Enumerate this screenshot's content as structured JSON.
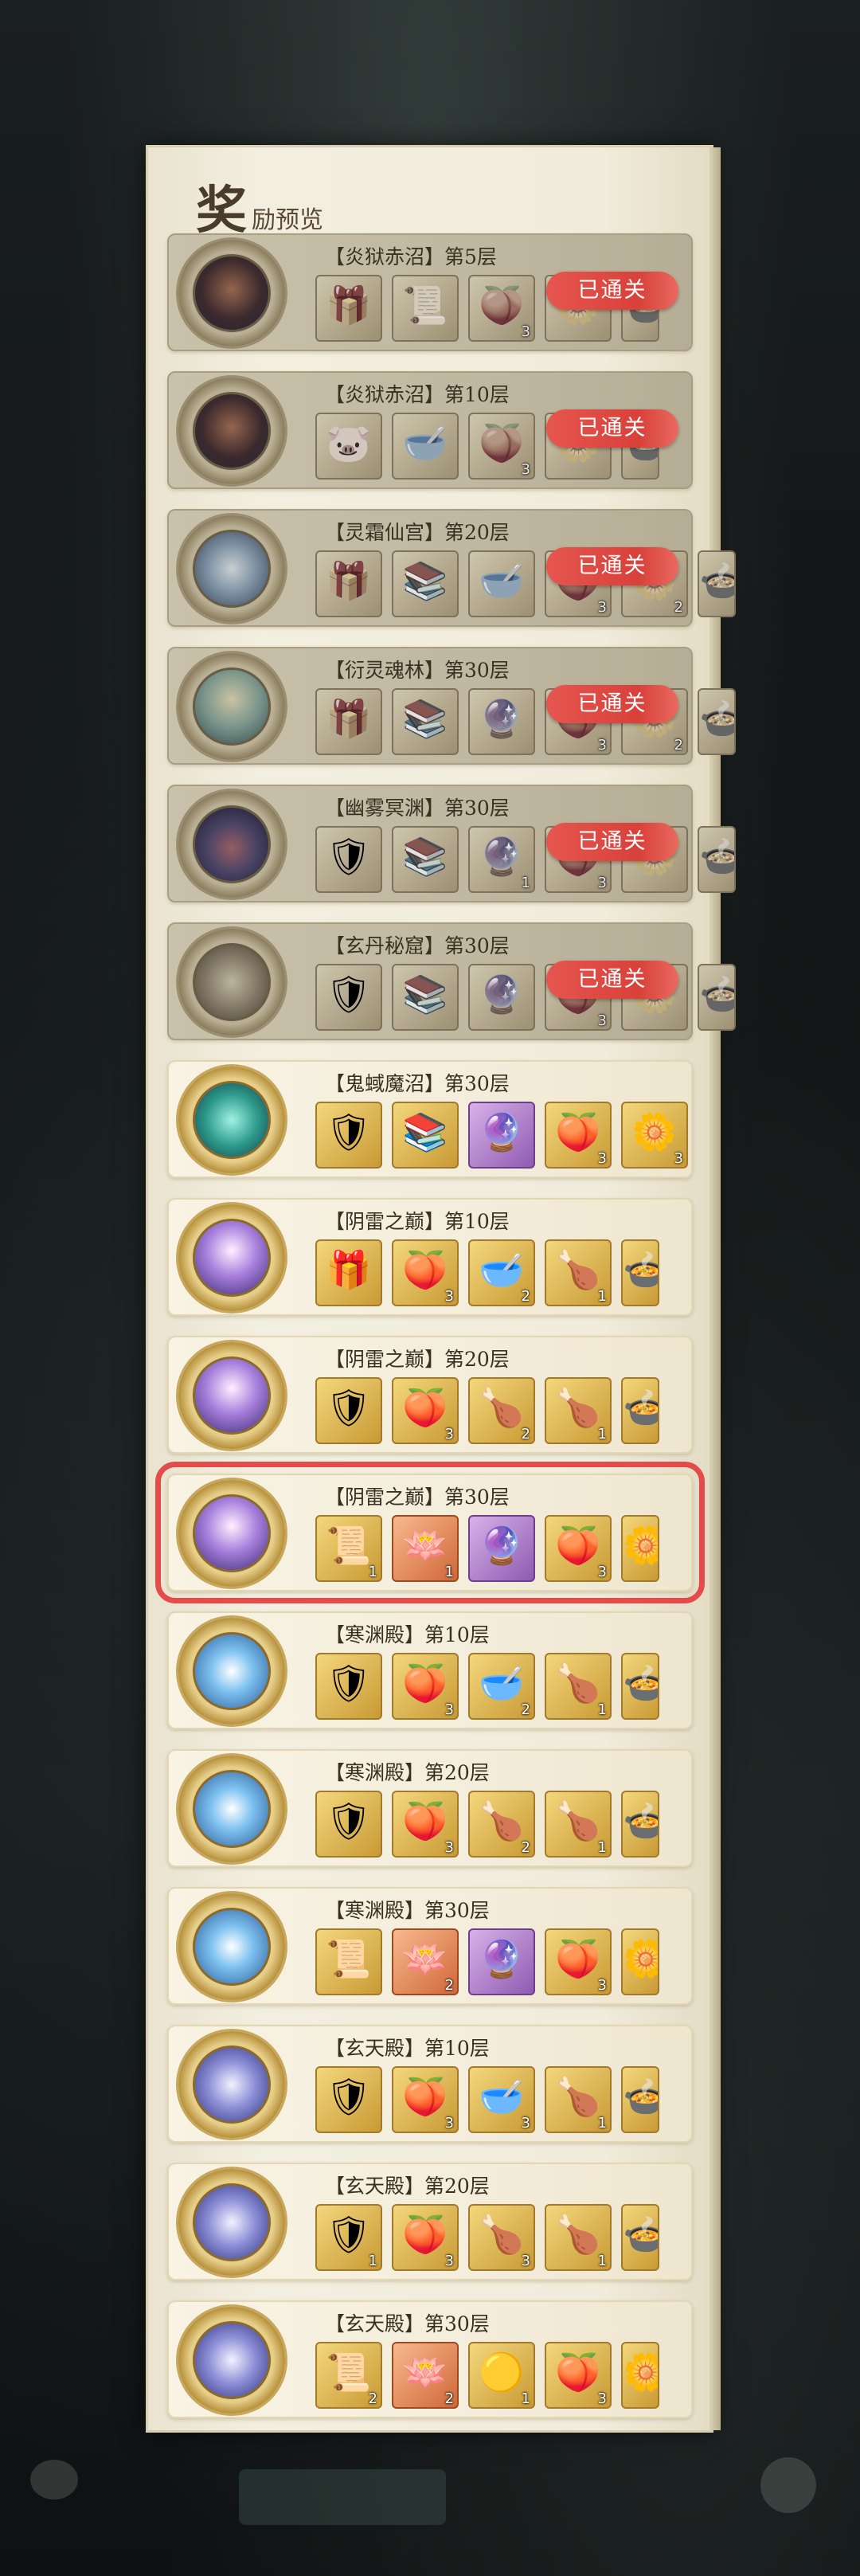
{
  "panel": {
    "title_big": "奖",
    "title_small": "励预览"
  },
  "passed_label": "已通关",
  "stages": [
    {
      "name": "【炎狱赤沼】第5层",
      "theme": "fire",
      "passed": true,
      "selected": false,
      "items": [
        {
          "icon": "chest-icon",
          "glyph": "🎁",
          "quality": "gold",
          "qty": ""
        },
        {
          "icon": "scroll-icon",
          "glyph": "📜",
          "quality": "gold",
          "qty": ""
        },
        {
          "icon": "peach-icon",
          "glyph": "🍑",
          "quality": "gold",
          "qty": "3"
        },
        {
          "icon": "lotus-icon",
          "glyph": "🌼",
          "quality": "gold",
          "qty": ""
        },
        {
          "icon": "dish-icon",
          "glyph": "🍲",
          "quality": "gold",
          "qty": "",
          "cut": true
        }
      ]
    },
    {
      "name": "【炎狱赤沼】第10层",
      "theme": "fire",
      "passed": true,
      "selected": false,
      "items": [
        {
          "icon": "spirit-beast-icon",
          "glyph": "🐷",
          "quality": "gold",
          "qty": ""
        },
        {
          "icon": "green-bowl-icon",
          "glyph": "🥣",
          "quality": "gold",
          "qty": ""
        },
        {
          "icon": "peach-icon",
          "glyph": "🍑",
          "quality": "gold",
          "qty": "3"
        },
        {
          "icon": "lotus-icon",
          "glyph": "🌼",
          "quality": "gold",
          "qty": ""
        },
        {
          "icon": "dish-icon",
          "glyph": "🍲",
          "quality": "gold",
          "qty": "",
          "cut": true
        }
      ]
    },
    {
      "name": "【灵霜仙宫】第20层",
      "theme": "frost",
      "passed": true,
      "selected": false,
      "items": [
        {
          "icon": "chest-icon",
          "glyph": "🎁",
          "quality": "gold",
          "qty": ""
        },
        {
          "icon": "book-icon",
          "glyph": "📚",
          "quality": "gold",
          "qty": ""
        },
        {
          "icon": "jade-bowl-icon",
          "glyph": "🥣",
          "quality": "gold",
          "qty": ""
        },
        {
          "icon": "peach-icon",
          "glyph": "🍑",
          "quality": "gold",
          "qty": "3"
        },
        {
          "icon": "lotus-icon",
          "glyph": "🌼",
          "quality": "gold",
          "qty": "2"
        },
        {
          "icon": "dish-icon",
          "glyph": "🍲",
          "quality": "gold",
          "qty": "",
          "cut": true
        }
      ]
    },
    {
      "name": "【衍灵魂林】第30层",
      "theme": "wood",
      "passed": true,
      "selected": false,
      "items": [
        {
          "icon": "chest-icon",
          "glyph": "🎁",
          "quality": "gold",
          "qty": ""
        },
        {
          "icon": "book-icon",
          "glyph": "📚",
          "quality": "gold",
          "qty": ""
        },
        {
          "icon": "orb-icon",
          "glyph": "🔮",
          "quality": "gold",
          "qty": ""
        },
        {
          "icon": "peach-icon",
          "glyph": "🍑",
          "quality": "gold",
          "qty": "3"
        },
        {
          "icon": "lotus-icon",
          "glyph": "🌼",
          "quality": "gold",
          "qty": "2"
        },
        {
          "icon": "dish-icon",
          "glyph": "🍲",
          "quality": "gold",
          "qty": "",
          "cut": true
        }
      ]
    },
    {
      "name": "【幽雾冥渊】第30层",
      "theme": "mist",
      "passed": true,
      "selected": false,
      "items": [
        {
          "icon": "armor-icon",
          "glyph": "🛡",
          "quality": "gold",
          "qty": ""
        },
        {
          "icon": "book-icon",
          "glyph": "📚",
          "quality": "gold",
          "qty": ""
        },
        {
          "icon": "orb-icon",
          "glyph": "🔮",
          "quality": "gold",
          "qty": "1"
        },
        {
          "icon": "peach-icon",
          "glyph": "🍑",
          "quality": "gold",
          "qty": "3"
        },
        {
          "icon": "lotus-icon",
          "glyph": "🌼",
          "quality": "gold",
          "qty": ""
        },
        {
          "icon": "dish-icon",
          "glyph": "🍲",
          "quality": "gold",
          "qty": "",
          "cut": true
        }
      ]
    },
    {
      "name": "【玄丹秘窟】第30层",
      "theme": "dan",
      "passed": true,
      "selected": false,
      "items": [
        {
          "icon": "armor-icon",
          "glyph": "🛡",
          "quality": "gold",
          "qty": ""
        },
        {
          "icon": "book-icon",
          "glyph": "📚",
          "quality": "gold",
          "qty": ""
        },
        {
          "icon": "orb-icon",
          "glyph": "🔮",
          "quality": "gold",
          "qty": ""
        },
        {
          "icon": "peach-icon",
          "glyph": "🍑",
          "quality": "gold",
          "qty": "3"
        },
        {
          "icon": "lotus-icon",
          "glyph": "🌼",
          "quality": "gold",
          "qty": ""
        },
        {
          "icon": "dish-icon",
          "glyph": "🍲",
          "quality": "gold",
          "qty": "",
          "cut": true
        }
      ]
    },
    {
      "name": "【鬼蜮魔沼】第30层",
      "theme": "ghost",
      "passed": false,
      "selected": false,
      "items": [
        {
          "icon": "armor-icon",
          "glyph": "🛡",
          "quality": "gold",
          "qty": ""
        },
        {
          "icon": "book-icon",
          "glyph": "📚",
          "quality": "gold",
          "qty": ""
        },
        {
          "icon": "orb-icon",
          "glyph": "🔮",
          "quality": "purple",
          "qty": ""
        },
        {
          "icon": "peach-icon",
          "glyph": "🍑",
          "quality": "gold",
          "qty": "3"
        },
        {
          "icon": "lotus-icon",
          "glyph": "🌼",
          "quality": "gold",
          "qty": "3"
        }
      ]
    },
    {
      "name": "【阴雷之巅】第10层",
      "theme": "thunder",
      "passed": false,
      "selected": false,
      "items": [
        {
          "icon": "chest-icon",
          "glyph": "🎁",
          "quality": "gold",
          "qty": ""
        },
        {
          "icon": "peach-icon",
          "glyph": "🍑",
          "quality": "gold",
          "qty": "3"
        },
        {
          "icon": "jade-bowl-icon",
          "glyph": "🥣",
          "quality": "gold",
          "qty": "2"
        },
        {
          "icon": "roast-dish-icon",
          "glyph": "🍗",
          "quality": "gold",
          "qty": "1"
        },
        {
          "icon": "dish-icon",
          "glyph": "🍲",
          "quality": "gold",
          "qty": "",
          "cut": true
        }
      ]
    },
    {
      "name": "【阴雷之巅】第20层",
      "theme": "thunder",
      "passed": false,
      "selected": false,
      "items": [
        {
          "icon": "armor-icon",
          "glyph": "🛡",
          "quality": "gold",
          "qty": ""
        },
        {
          "icon": "peach-icon",
          "glyph": "🍑",
          "quality": "gold",
          "qty": "3"
        },
        {
          "icon": "drumstick-icon",
          "glyph": "🍗",
          "quality": "gold",
          "qty": "2"
        },
        {
          "icon": "roast-dish-icon",
          "glyph": "🍗",
          "quality": "gold",
          "qty": "1"
        },
        {
          "icon": "dish-icon",
          "glyph": "🍲",
          "quality": "gold",
          "qty": "",
          "cut": true
        }
      ]
    },
    {
      "name": "【阴雷之巅】第30层",
      "theme": "thunder",
      "passed": false,
      "selected": true,
      "items": [
        {
          "icon": "talisman-icon",
          "glyph": "📜",
          "quality": "gold",
          "qty": "1"
        },
        {
          "icon": "fire-lotus-icon",
          "glyph": "🪷",
          "quality": "orange",
          "qty": "1"
        },
        {
          "icon": "orb-icon",
          "glyph": "🔮",
          "quality": "purple",
          "qty": ""
        },
        {
          "icon": "peach-icon",
          "glyph": "🍑",
          "quality": "gold",
          "qty": "3"
        },
        {
          "icon": "lotus-icon",
          "glyph": "🌼",
          "quality": "gold",
          "qty": "",
          "cut": true
        }
      ]
    },
    {
      "name": "【寒渊殿】第10层",
      "theme": "cold",
      "passed": false,
      "selected": false,
      "items": [
        {
          "icon": "armor-icon",
          "glyph": "🛡",
          "quality": "gold",
          "qty": ""
        },
        {
          "icon": "peach-icon",
          "glyph": "🍑",
          "quality": "gold",
          "qty": "3"
        },
        {
          "icon": "jade-bowl-icon",
          "glyph": "🥣",
          "quality": "gold",
          "qty": "2"
        },
        {
          "icon": "roast-dish-icon",
          "glyph": "🍗",
          "quality": "gold",
          "qty": "1"
        },
        {
          "icon": "dish-icon",
          "glyph": "🍲",
          "quality": "gold",
          "qty": "",
          "cut": true
        }
      ]
    },
    {
      "name": "【寒渊殿】第20层",
      "theme": "cold",
      "passed": false,
      "selected": false,
      "items": [
        {
          "icon": "armor-icon",
          "glyph": "🛡",
          "quality": "gold",
          "qty": ""
        },
        {
          "icon": "peach-icon",
          "glyph": "🍑",
          "quality": "gold",
          "qty": "3"
        },
        {
          "icon": "drumstick-icon",
          "glyph": "🍗",
          "quality": "gold",
          "qty": "2"
        },
        {
          "icon": "roast-dish-icon",
          "glyph": "🍗",
          "quality": "gold",
          "qty": "1"
        },
        {
          "icon": "dish-icon",
          "glyph": "🍲",
          "quality": "gold",
          "qty": "",
          "cut": true
        }
      ]
    },
    {
      "name": "【寒渊殿】第30层",
      "theme": "cold",
      "passed": false,
      "selected": false,
      "items": [
        {
          "icon": "talisman-icon",
          "glyph": "📜",
          "quality": "gold",
          "qty": ""
        },
        {
          "icon": "fire-lotus-icon",
          "glyph": "🪷",
          "quality": "orange",
          "qty": "2"
        },
        {
          "icon": "orb-icon",
          "glyph": "🔮",
          "quality": "purple",
          "qty": ""
        },
        {
          "icon": "peach-icon",
          "glyph": "🍑",
          "quality": "gold",
          "qty": "3"
        },
        {
          "icon": "lotus-icon",
          "glyph": "🌼",
          "quality": "gold",
          "qty": "",
          "cut": true
        }
      ]
    },
    {
      "name": "【玄天殿】第10层",
      "theme": "xuan",
      "passed": false,
      "selected": false,
      "items": [
        {
          "icon": "armor-icon",
          "glyph": "🛡",
          "quality": "gold",
          "qty": ""
        },
        {
          "icon": "peach-icon",
          "glyph": "🍑",
          "quality": "gold",
          "qty": "3"
        },
        {
          "icon": "jade-bowl-icon",
          "glyph": "🥣",
          "quality": "gold",
          "qty": "3"
        },
        {
          "icon": "roast-dish-icon",
          "glyph": "🍗",
          "quality": "gold",
          "qty": "1"
        },
        {
          "icon": "dish-icon",
          "glyph": "🍲",
          "quality": "gold",
          "qty": "",
          "cut": true
        }
      ]
    },
    {
      "name": "【玄天殿】第20层",
      "theme": "xuan",
      "passed": false,
      "selected": false,
      "items": [
        {
          "icon": "armor-icon",
          "glyph": "🛡",
          "quality": "gold",
          "qty": "1"
        },
        {
          "icon": "peach-icon",
          "glyph": "🍑",
          "quality": "gold",
          "qty": "3"
        },
        {
          "icon": "drumstick-icon",
          "glyph": "🍗",
          "quality": "gold",
          "qty": "3"
        },
        {
          "icon": "roast-dish-icon",
          "glyph": "🍗",
          "quality": "gold",
          "qty": "1"
        },
        {
          "icon": "dish-icon",
          "glyph": "🍲",
          "quality": "gold",
          "qty": "",
          "cut": true
        }
      ]
    },
    {
      "name": "【玄天殿】第30层",
      "theme": "xuan",
      "passed": false,
      "selected": false,
      "items": [
        {
          "icon": "talisman-icon",
          "glyph": "📜",
          "quality": "gold",
          "qty": "2"
        },
        {
          "icon": "fire-lotus-icon",
          "glyph": "🪷",
          "quality": "orange",
          "qty": "2"
        },
        {
          "icon": "gold-orb-icon",
          "glyph": "🟡",
          "quality": "gold",
          "qty": "1"
        },
        {
          "icon": "peach-icon",
          "glyph": "🍑",
          "quality": "gold",
          "qty": "3"
        },
        {
          "icon": "lotus-icon",
          "glyph": "🌼",
          "quality": "gold",
          "qty": "",
          "cut": true
        }
      ]
    }
  ]
}
